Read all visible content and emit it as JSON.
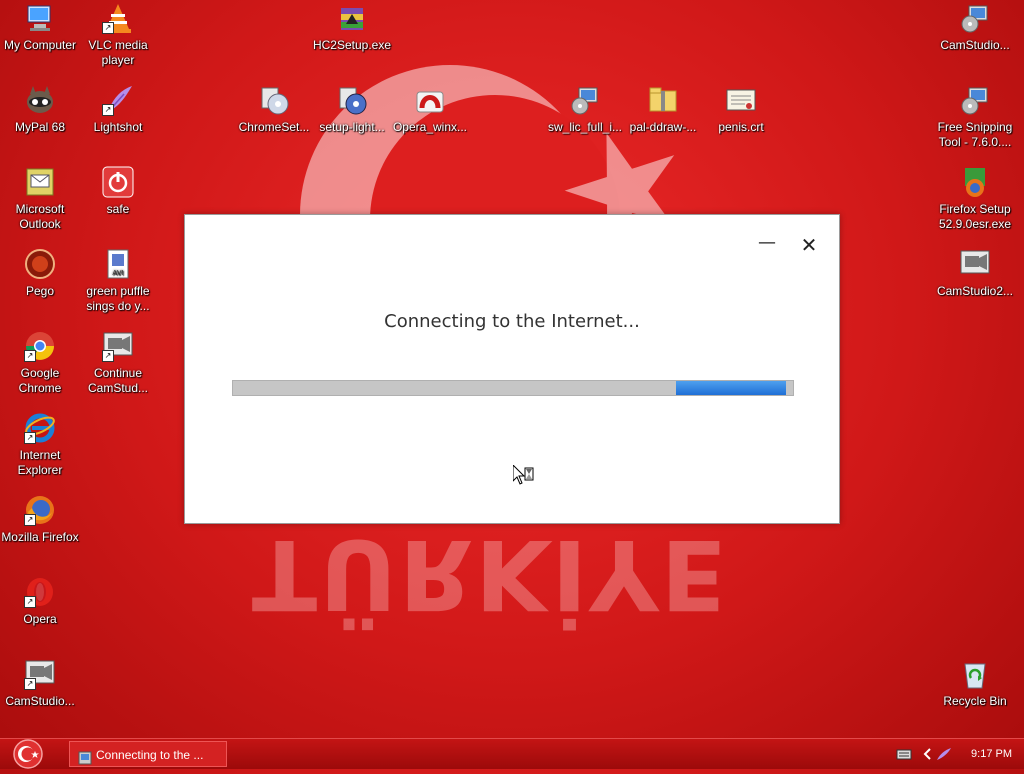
{
  "desktop": {
    "icons": [
      {
        "label": "My Computer",
        "icon": "my-computer-icon"
      },
      {
        "label": "VLC media player",
        "icon": "vlc-icon"
      },
      {
        "label": "HC2Setup.exe",
        "icon": "winrar-archive-icon"
      },
      {
        "label": "CamStudio...",
        "icon": "camstudio-setup-icon"
      },
      {
        "label": "MyPal 68",
        "icon": "mypal-icon"
      },
      {
        "label": "Lightshot",
        "icon": "lightshot-feather-icon"
      },
      {
        "label": "ChromeSet...",
        "icon": "installer-disc-icon"
      },
      {
        "label": "setup-light...",
        "icon": "installer-disc-icon"
      },
      {
        "label": "Opera_winx...",
        "icon": "opera-installer-icon"
      },
      {
        "label": "sw_lic_full_i...",
        "icon": "setup-icon"
      },
      {
        "label": "pal-ddraw-...",
        "icon": "zip-folder-icon"
      },
      {
        "label": "penis.crt",
        "icon": "certificate-icon"
      },
      {
        "label": "Free Snipping Tool - 7.6.0....",
        "icon": "setup-icon"
      },
      {
        "label": "Microsoft Outlook",
        "icon": "outlook-icon"
      },
      {
        "label": "safe",
        "icon": "power-safe-icon"
      },
      {
        "label": "Firefox Setup 52.9.0esr.exe",
        "icon": "firefox-setup-icon"
      },
      {
        "label": "Pego",
        "icon": "pego-icon"
      },
      {
        "label": "green puffle sings do y...",
        "icon": "avi-file-icon"
      },
      {
        "label": "CamStudio2...",
        "icon": "camstudio-icon"
      },
      {
        "label": "Google Chrome",
        "icon": "chrome-icon"
      },
      {
        "label": "Continue CamStud...",
        "icon": "camstudio-icon"
      },
      {
        "label": "Internet Explorer",
        "icon": "internet-explorer-icon"
      },
      {
        "label": "Mozilla Firefox",
        "icon": "firefox-icon"
      },
      {
        "label": "Opera",
        "icon": "opera-icon"
      },
      {
        "label": "CamStudio...",
        "icon": "camstudio-icon"
      },
      {
        "label": "Recycle Bin",
        "icon": "recycle-bin-icon"
      }
    ]
  },
  "wallpaper": {
    "text": "TÜRKİYE"
  },
  "dialog": {
    "message": "Connecting to the Internet...",
    "minimize_glyph": "—",
    "close_glyph": "✕"
  },
  "taskbar": {
    "task_label": "Connecting to the ...",
    "clock": "9:17 PM"
  },
  "colors": {
    "accent": "#d01818",
    "progress": "#2f7fe0"
  }
}
